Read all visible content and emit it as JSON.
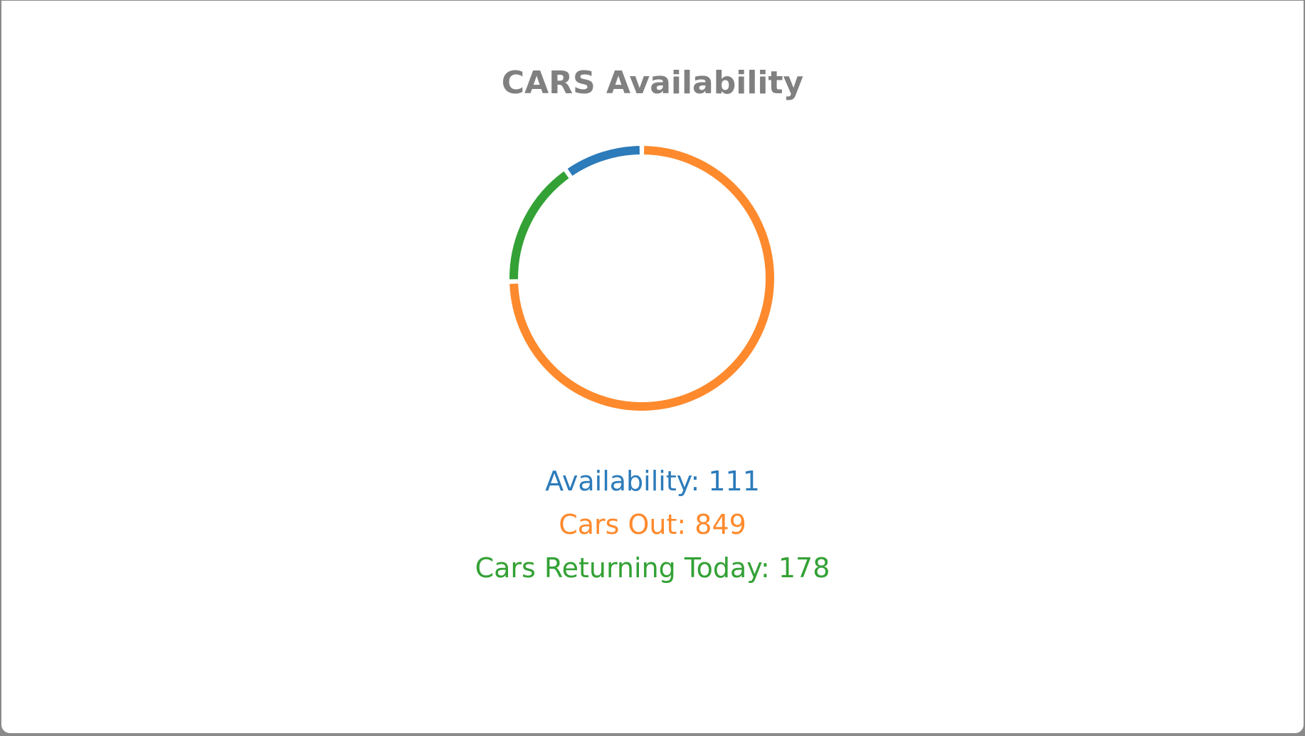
{
  "chart_data": {
    "type": "pie",
    "variant": "donut",
    "title": "CARS Availability",
    "series": [
      {
        "name": "Availability",
        "value": 111,
        "color": "#2c7bba"
      },
      {
        "name": "Cars Out",
        "value": 849,
        "color": "#fe8a2d"
      },
      {
        "name": "Cars Returning Today",
        "value": 178,
        "color": "#33a135"
      }
    ],
    "legend_position": "bottom",
    "labels": [
      "Availability: 111",
      "Cars Out: 849",
      "Cars Returning Today: 178"
    ]
  }
}
